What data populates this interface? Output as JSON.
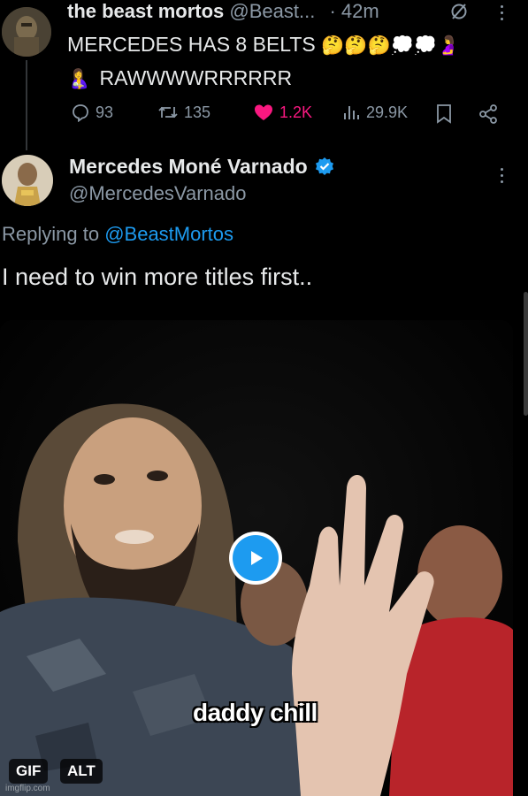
{
  "parent_tweet": {
    "display_name": "the beast mortos",
    "handle": "@Beast...",
    "time": "· 42m",
    "text_line1": "MERCEDES HAS 8 BELTS",
    "text_line1_emojis": "🤔🤔🤔💭💭🤰",
    "text_line2_emoji": "🤱",
    "text_line2": "RAWWWWRRRRRR",
    "replies": "93",
    "reposts": "135",
    "likes": "1.2K",
    "views": "29.9K"
  },
  "reply_tweet": {
    "display_name": "Mercedes Moné Varnado",
    "handle": "@MercedesVarnado",
    "replying_prefix": "Replying to",
    "replying_to": "@BeastMortos",
    "text": "I need to win more titles first.."
  },
  "media": {
    "caption": "daddy chill",
    "gif_badge": "GIF",
    "alt_badge": "ALT",
    "watermark": "imgflip.com"
  },
  "colors": {
    "background": "#000000",
    "text_primary": "#e7e9ea",
    "text_secondary": "#8b98a5",
    "link": "#1d9bf0",
    "like": "#f91880",
    "verified": "#1d9bf0"
  }
}
